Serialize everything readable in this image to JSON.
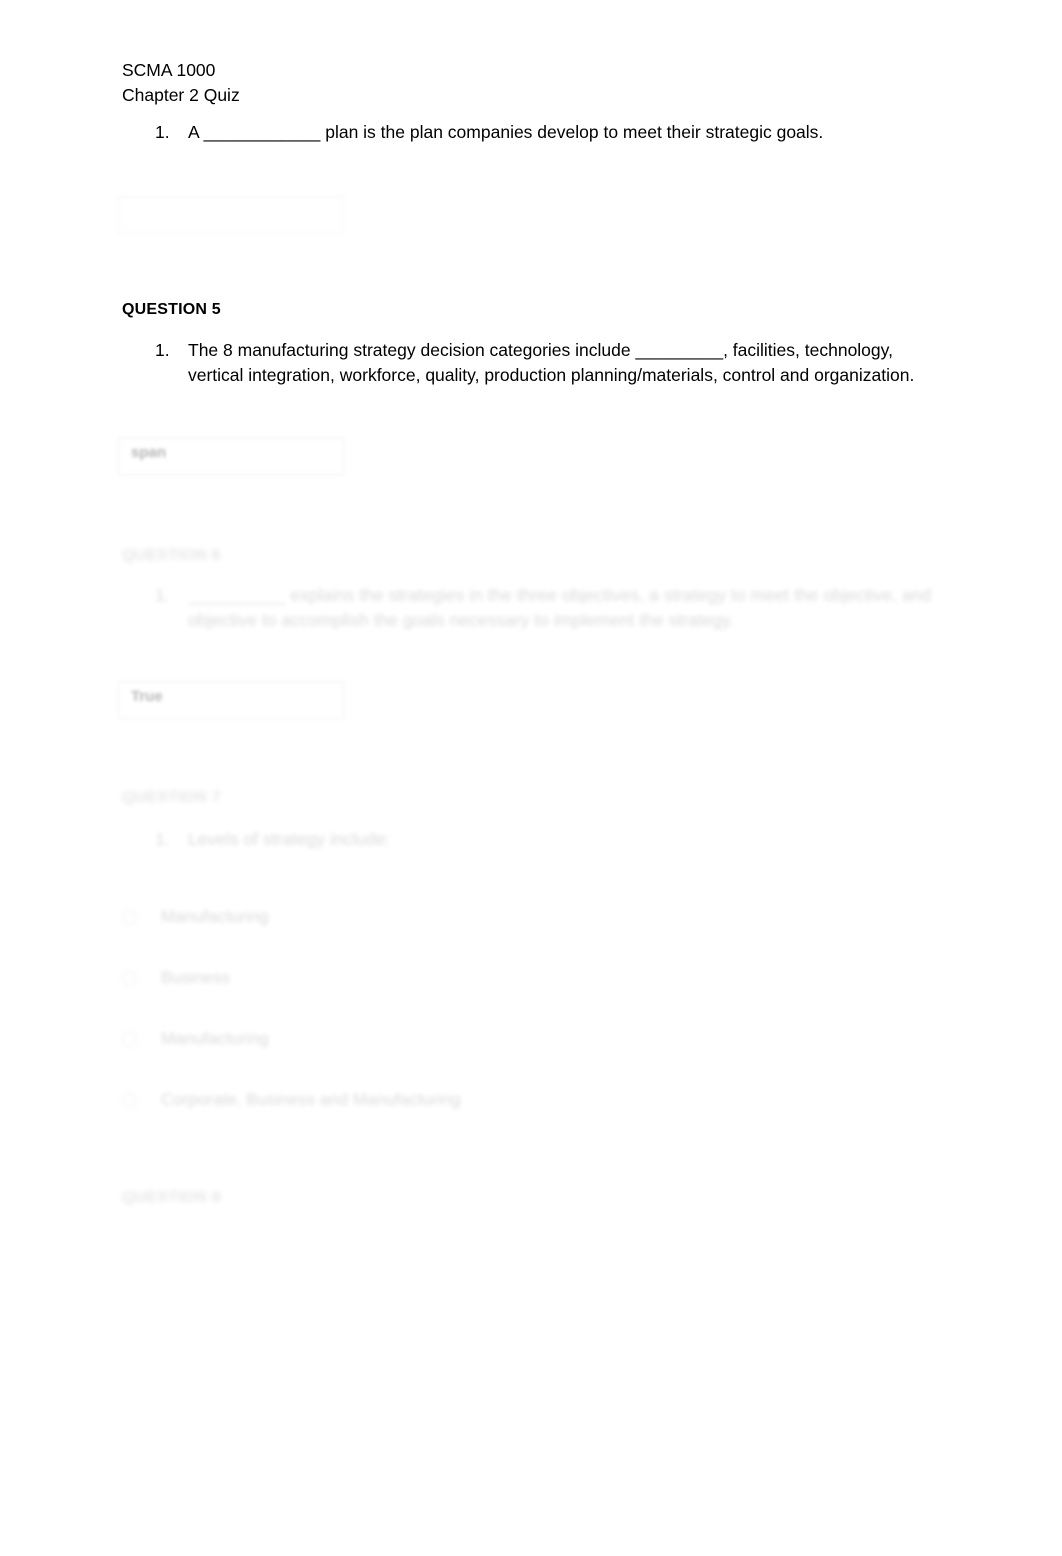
{
  "document": {
    "course_code": "SCMA 1000",
    "title": "Chapter 2 Quiz"
  },
  "questions": [
    {
      "heading": "",
      "number": "1.",
      "text": "A ____________ plan is the plan companies develop to meet their strategic goals.",
      "answer_value": ""
    },
    {
      "heading": "QUESTION 5",
      "number": "1.",
      "text": "The 8 manufacturing strategy decision categories include _________, facilities, technology, vertical integration, workforce, quality, production planning/materials, control and organization.",
      "answer_value": "span"
    },
    {
      "heading": "QUESTION 6",
      "number": "1.",
      "text": "__________ explains the strategies in the three objectives, a strategy to meet the objective, and objective to accomplish the goals necessary to implement the strategy.",
      "answer_value": "True"
    },
    {
      "heading": "QUESTION 7",
      "number": "1.",
      "text": "Levels of strategy include:",
      "options": [
        "Manufacturing",
        "Business",
        "Manufacturing",
        "Corporate, Business and Manufacturing"
      ]
    },
    {
      "heading": "QUESTION 8"
    }
  ]
}
